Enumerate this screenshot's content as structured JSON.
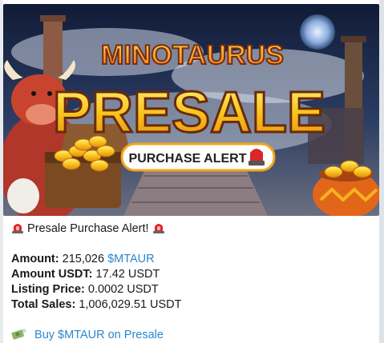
{
  "banner": {
    "logo_text": "MINOTAURUS",
    "headline": "PRESALE",
    "badge_text": "PURCHASE ALERT",
    "colors": {
      "sky": "#1c2a4a",
      "gold": "#f5b21d",
      "orange": "#e2661a",
      "badge_red": "#d8262b"
    }
  },
  "message": {
    "heading": "Presale Purchase Alert!",
    "amount_label": "Amount:",
    "amount_value": "215,026",
    "amount_token": "$MTAUR",
    "usdt_label": "Amount USDT:",
    "usdt_value": "17.42 USDT",
    "listing_label": "Listing Price:",
    "listing_value": "0.0002 USDT",
    "total_label": "Total Sales:",
    "total_value": "1,006,029.51 USDT",
    "buy_link": "Buy $MTAUR on Presale",
    "link_color": "#2a87d0",
    "heading_icon": "siren-icon",
    "buy_icon": "money-icon"
  }
}
